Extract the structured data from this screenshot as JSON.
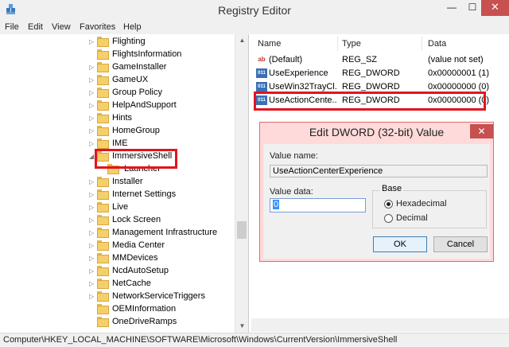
{
  "window": {
    "title": "Registry Editor",
    "minimize_glyph": "—",
    "maximize_glyph": "☐",
    "close_glyph": "✕"
  },
  "menu": [
    "File",
    "Edit",
    "View",
    "Favorites",
    "Help"
  ],
  "tree": {
    "items": [
      {
        "label": "Flighting",
        "expandable": true
      },
      {
        "label": "FlightsInformation",
        "expandable": false
      },
      {
        "label": "GameInstaller",
        "expandable": true
      },
      {
        "label": "GameUX",
        "expandable": true
      },
      {
        "label": "Group Policy",
        "expandable": true
      },
      {
        "label": "HelpAndSupport",
        "expandable": true
      },
      {
        "label": "Hints",
        "expandable": true
      },
      {
        "label": "HomeGroup",
        "expandable": true
      },
      {
        "label": "IME",
        "expandable": true
      },
      {
        "label": "ImmersiveShell",
        "expandable": true,
        "expanded": true,
        "selected": true
      },
      {
        "label": "Launcher",
        "expandable": false,
        "child": true
      },
      {
        "label": "Installer",
        "expandable": true
      },
      {
        "label": "Internet Settings",
        "expandable": true
      },
      {
        "label": "Live",
        "expandable": true
      },
      {
        "label": "Lock Screen",
        "expandable": true
      },
      {
        "label": "Management Infrastructure",
        "expandable": true
      },
      {
        "label": "Media Center",
        "expandable": true
      },
      {
        "label": "MMDevices",
        "expandable": true
      },
      {
        "label": "NcdAutoSetup",
        "expandable": true
      },
      {
        "label": "NetCache",
        "expandable": true
      },
      {
        "label": "NetworkServiceTriggers",
        "expandable": true
      },
      {
        "label": "OEMInformation",
        "expandable": false
      },
      {
        "label": "OneDriveRamps",
        "expandable": false
      }
    ]
  },
  "list": {
    "headers": {
      "name": "Name",
      "type": "Type",
      "data": "Data"
    },
    "rows": [
      {
        "icon": "ab",
        "icon_name": "string-value-icon",
        "name": "(Default)",
        "type": "REG_SZ",
        "data": "(value not set)"
      },
      {
        "icon": "011",
        "icon_name": "dword-value-icon",
        "name": "UseExperience",
        "type": "REG_DWORD",
        "data": "0x00000001 (1)"
      },
      {
        "icon": "011",
        "icon_name": "dword-value-icon",
        "name": "UseWin32TrayCl...",
        "type": "REG_DWORD",
        "data": "0x00000000 (0)"
      },
      {
        "icon": "011",
        "icon_name": "dword-value-icon",
        "name": "UseActionCente...",
        "type": "REG_DWORD",
        "data": "0x00000000 (0)"
      }
    ]
  },
  "status": {
    "path": "Computer\\HKEY_LOCAL_MACHINE\\SOFTWARE\\Microsoft\\Windows\\CurrentVersion\\ImmersiveShell"
  },
  "dialog": {
    "title": "Edit DWORD (32-bit) Value",
    "close_glyph": "✕",
    "value_name_label": "Value name:",
    "value_name": "UseActionCenterExperience",
    "value_data_label": "Value data:",
    "value_data": "0",
    "base_label": "Base",
    "hex_label": "Hexadecimal",
    "dec_label": "Decimal",
    "base_selected": "Hexadecimal",
    "ok_label": "OK",
    "cancel_label": "Cancel"
  },
  "colors": {
    "highlight": "#e3141e",
    "dialog_frame": "#ffdada",
    "close_button": "#c75050"
  }
}
